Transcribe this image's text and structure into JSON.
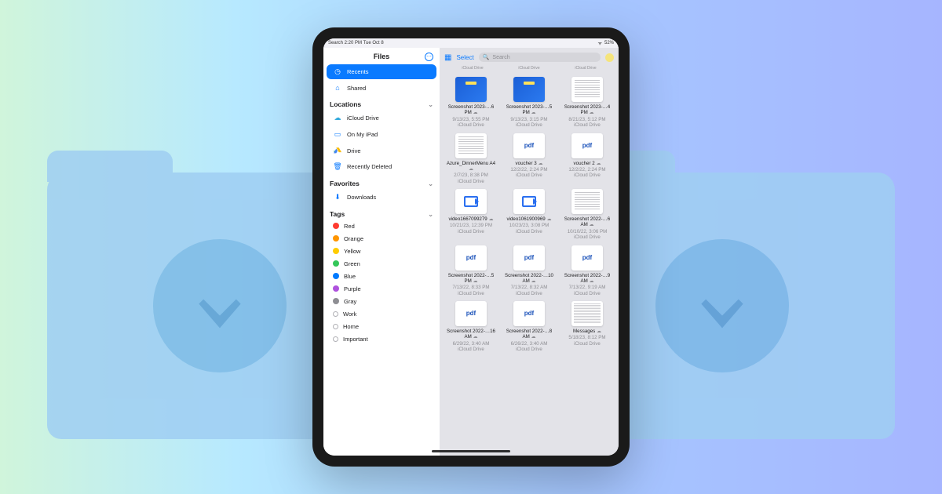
{
  "status": {
    "left": "Search  2:20 PM  Tue Oct 8",
    "battery": "52%"
  },
  "sidebar": {
    "title": "Files",
    "recents": "Recents",
    "shared": "Shared",
    "locations_head": "Locations",
    "icloud": "iCloud Drive",
    "onipad": "On My iPad",
    "drive": "Drive",
    "deleted": "Recently Deleted",
    "favorites_head": "Favorites",
    "downloads": "Downloads",
    "tags_head": "Tags",
    "tags": {
      "red": "Red",
      "orange": "Orange",
      "yellow": "Yellow",
      "green": "Green",
      "blue": "Blue",
      "purple": "Purple",
      "gray": "Gray",
      "work": "Work",
      "home": "Home",
      "important": "Important"
    }
  },
  "toolbar": {
    "select": "Select",
    "search_placeholder": "Search"
  },
  "loc_label": "iCloud Drive",
  "files": [
    {
      "name": "Screenshot 2023-…6 PM",
      "date": "9/13/23, 5:55 PM",
      "kind": "img-blue"
    },
    {
      "name": "Screenshot 2023-…5 PM",
      "date": "9/13/23, 3:15 PM",
      "kind": "img-blue"
    },
    {
      "name": "Screenshot 2023-…4 PM",
      "date": "8/21/23, 5:12 PM",
      "kind": "textimg"
    },
    {
      "name": "Azure_DinnerMenu A4",
      "date": "2/7/23, 8:38 PM",
      "kind": "textimg"
    },
    {
      "name": "voucher 3",
      "date": "12/2/22, 2:24 PM",
      "kind": "pdf"
    },
    {
      "name": "voucher 2",
      "date": "12/2/22, 2:24 PM",
      "kind": "pdf"
    },
    {
      "name": "video1667099279",
      "date": "10/21/23, 12:39 PM",
      "kind": "video"
    },
    {
      "name": "video1061900969",
      "date": "10/23/23, 3:08 PM",
      "kind": "video"
    },
    {
      "name": "Screenshot 2022-…6 AM",
      "date": "10/10/22, 3:06 PM",
      "kind": "textimg"
    },
    {
      "name": "Screenshot 2022-…5 PM",
      "date": "7/13/22, 8:33 PM",
      "kind": "pdf"
    },
    {
      "name": "Screenshot 2022-…10 AM",
      "date": "7/13/22, 8:32 AM",
      "kind": "pdf"
    },
    {
      "name": "Screenshot 2022-…9 AM",
      "date": "7/13/22, 9:19 AM",
      "kind": "pdf"
    },
    {
      "name": "Screenshot 2022-…16 AM",
      "date": "6/29/22, 3:40 AM",
      "kind": "pdf"
    },
    {
      "name": "Screenshot 2022-…8 AM",
      "date": "6/26/22, 3:40 AM",
      "kind": "pdf"
    },
    {
      "name": "Messages",
      "date": "5/18/23, 8:12 PM",
      "kind": "lines"
    }
  ],
  "colors": {
    "red": "#ff3b30",
    "orange": "#ff9500",
    "yellow": "#ffcc00",
    "green": "#34c759",
    "blue": "#007aff",
    "purple": "#af52de",
    "gray": "#8e8e93"
  }
}
